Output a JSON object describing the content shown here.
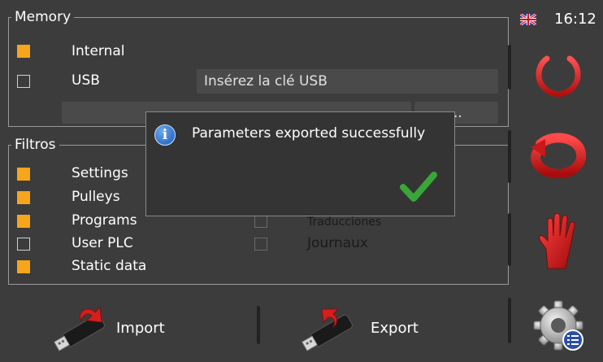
{
  "status": {
    "language_flag": "uk-flag-icon",
    "time": "16:12"
  },
  "memory": {
    "title": "Memory",
    "options": [
      {
        "label": "Internal",
        "checked": true
      },
      {
        "label": "USB",
        "checked": false
      }
    ],
    "usb_message": "Insérez la clé USB",
    "browse_label": ".."
  },
  "filters": {
    "title": "Filtros",
    "left_items": [
      {
        "label": "Settings",
        "checked": true
      },
      {
        "label": "Pulleys",
        "checked": true
      },
      {
        "label": "Programs",
        "checked": true
      },
      {
        "label": "User PLC",
        "checked": false
      },
      {
        "label": "Static data",
        "checked": true
      }
    ],
    "right_items": [
      {
        "label": "Traducciones",
        "checked": false
      },
      {
        "label": "Journaux",
        "checked": false
      }
    ]
  },
  "dialog": {
    "message": "Parameters exported successfully",
    "icon": "info-icon",
    "confirm_icon": "checkmark-icon"
  },
  "bottom": {
    "import_label": "Import",
    "export_label": "Export"
  },
  "side_buttons": [
    "power-icon",
    "refresh-icon",
    "stop-hand-icon",
    "settings-gear-icon"
  ],
  "colors": {
    "accent": "#f7a51d",
    "danger": "#d41f1f",
    "success": "#3aa63a",
    "info": "#2f72c9",
    "background": "#3c3c3c"
  }
}
